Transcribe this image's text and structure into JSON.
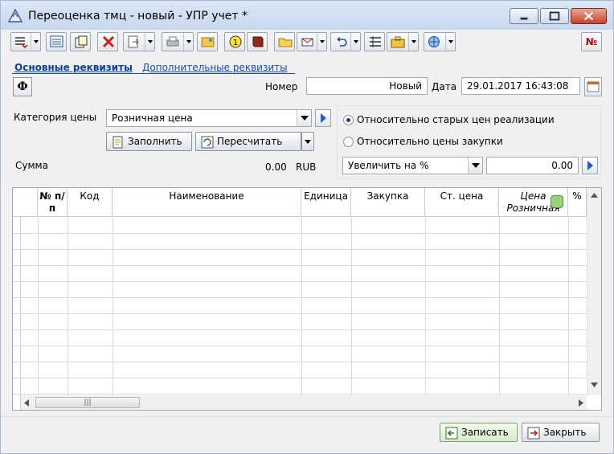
{
  "window": {
    "title": "Переоценка тмц - новый - УПР учет *",
    "icon": "app-triangle-icon"
  },
  "toolbar": {
    "no_label": "№"
  },
  "tabs": {
    "main": "Основные реквизиты",
    "extra": "Дополнительные реквизиты"
  },
  "header": {
    "f_label": "Ф",
    "number_label": "Номер",
    "number_value": "Новый",
    "date_label": "Дата",
    "date_value": "29.01.2017 16:43:08"
  },
  "price": {
    "category_label": "Категория цены",
    "category_value": "Розничная цена",
    "fill_label": "Заполнить",
    "recalc_label": "Пересчитать",
    "sum_label": "Сумма",
    "sum_value": "0.00",
    "currency": "RUB"
  },
  "options": {
    "radio_old": "Относительно старых цен реализации",
    "radio_purchase": "Относительно цены закупки",
    "selected": "radio_old",
    "change_mode": "Увеличить на %",
    "change_value": "0.00"
  },
  "table": {
    "columns": [
      {
        "key": "num",
        "label": "№ п/п"
      },
      {
        "key": "code",
        "label": "Код"
      },
      {
        "key": "name",
        "label": "Наименование"
      },
      {
        "key": "unit",
        "label": "Единица"
      },
      {
        "key": "purchase",
        "label": "Закупка"
      },
      {
        "key": "old_price",
        "label": "Ст. цена"
      },
      {
        "key": "new_price",
        "label": "Цена Розничная"
      },
      {
        "key": "percent",
        "label": "%"
      }
    ],
    "rows": []
  },
  "footer": {
    "save_label": "Записать",
    "close_label": "Закрыть"
  }
}
